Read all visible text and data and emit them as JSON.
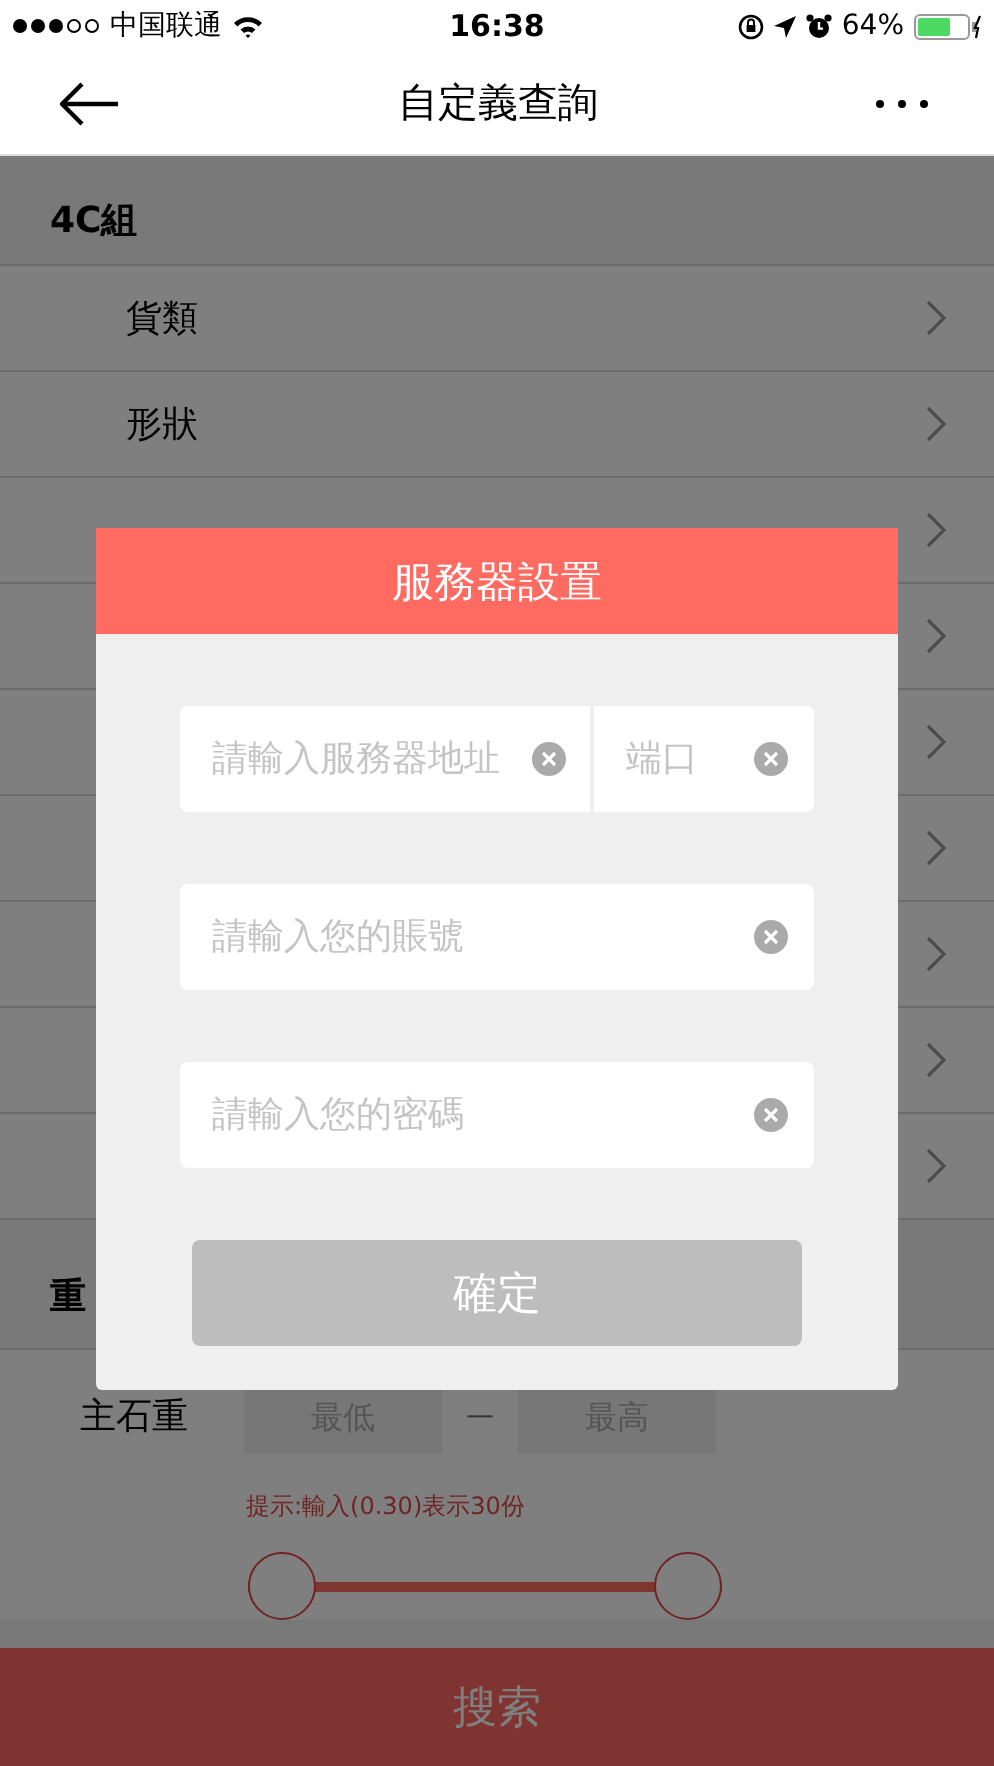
{
  "status_bar": {
    "carrier": "中国联通",
    "time": "16:38",
    "battery": "64%"
  },
  "nav": {
    "title": "自定義查詢"
  },
  "section": {
    "title": "4C組",
    "rows": [
      {
        "kind": "labeled",
        "label": "貨類"
      },
      {
        "kind": "labeled",
        "label": "形狀"
      },
      {
        "kind": "covered"
      },
      {
        "kind": "covered"
      },
      {
        "kind": "covered"
      },
      {
        "kind": "covered"
      },
      {
        "kind": "covered"
      },
      {
        "kind": "covered"
      },
      {
        "kind": "covered"
      }
    ]
  },
  "weight_section": {
    "title": "重",
    "label": "主石重",
    "min_placeholder": "最低",
    "separator": "—",
    "max_placeholder": "最高",
    "hint": "提示:輸入(0.30)表示30份",
    "thumbs": [
      {
        "level": 0
      },
      {
        "level": 1
      }
    ]
  },
  "search_button": "搜索",
  "dialog": {
    "title": "服務器設置",
    "address_placeholder": "請輸入服務器地址",
    "port_placeholder": "端口",
    "account_placeholder": "請輸入您的賬號",
    "password_placeholder": "請輸入您的密碼",
    "confirm": "確定"
  }
}
